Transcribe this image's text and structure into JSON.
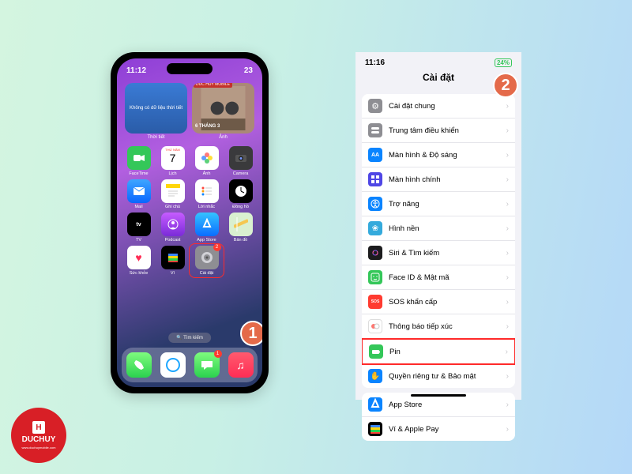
{
  "phone1": {
    "time": "11:12",
    "battery": "23",
    "widgets": {
      "weather": {
        "label": "Thời tiết",
        "text": "Không có dữ liệu thời tiết"
      },
      "photo": {
        "label": "Ảnh",
        "tag": "DUC HUY MOBILE",
        "date": "6 THÁNG 3"
      }
    },
    "apps_row1": [
      {
        "label": "FaceTime",
        "bg": "#34c759",
        "glyph": "video"
      },
      {
        "label": "Lịch",
        "bg": "#ffffff",
        "glyph": "calendar",
        "top": "THỨ NĂM",
        "num": "7"
      },
      {
        "label": "Ảnh",
        "bg": "#ffffff",
        "glyph": "photos"
      },
      {
        "label": "Camera",
        "bg": "#3a3a3c",
        "glyph": "camera"
      }
    ],
    "apps_row2": [
      {
        "label": "Mail",
        "bg": "linear-gradient(#3ea5ff,#0a66ff)",
        "glyph": "mail"
      },
      {
        "label": "Ghi chú",
        "bg": "#ffffff",
        "glyph": "notes"
      },
      {
        "label": "Lời nhắc",
        "bg": "#ffffff",
        "glyph": "reminders"
      },
      {
        "label": "Đồng hồ",
        "bg": "#000000",
        "glyph": "clock"
      }
    ],
    "apps_row3": [
      {
        "label": "TV",
        "bg": "#000000",
        "glyph": "tv"
      },
      {
        "label": "Podcast",
        "bg": "linear-gradient(#c65cff,#7a2bd8)",
        "glyph": "podcast"
      },
      {
        "label": "App Store",
        "bg": "linear-gradient(#35c3ff,#0a6cff)",
        "glyph": "appstore"
      },
      {
        "label": "Bản đồ",
        "bg": "#d9f0d0",
        "glyph": "maps"
      }
    ],
    "apps_row4": [
      {
        "label": "Sức khỏe",
        "bg": "#ffffff",
        "glyph": "health"
      },
      {
        "label": "Ví",
        "bg": "#000000",
        "glyph": "wallet"
      },
      {
        "label": "Cài đặt",
        "bg": "#8e8e93",
        "glyph": "settings",
        "badge": "2",
        "highlight": true
      }
    ],
    "search": "Tìm kiếm",
    "dock": [
      {
        "name": "phone",
        "bg": "linear-gradient(#7efc7e,#2bd14f)"
      },
      {
        "name": "safari",
        "bg": "#ffffff"
      },
      {
        "name": "messages",
        "bg": "linear-gradient(#7efc7e,#2bd14f)",
        "badge": "1"
      },
      {
        "name": "music",
        "bg": "linear-gradient(#ff5a6e,#ff2d55)"
      }
    ],
    "step": "1"
  },
  "phone2": {
    "time": "11:16",
    "battery": "24%",
    "title": "Cài đặt",
    "step": "2",
    "group1": [
      {
        "label": "Cài đặt chung",
        "bg": "#8e8e93",
        "glyph": "gear"
      },
      {
        "label": "Trung tâm điều khiển",
        "bg": "#8e8e93",
        "glyph": "switches"
      },
      {
        "label": "Màn hình & Độ sáng",
        "bg": "#0a84ff",
        "glyph": "AA"
      },
      {
        "label": "Màn hình chính",
        "bg": "#4f46e5",
        "glyph": "grid"
      },
      {
        "label": "Trợ năng",
        "bg": "#0a84ff",
        "glyph": "access"
      },
      {
        "label": "Hình nền",
        "bg": "#34aadc",
        "glyph": "flower"
      },
      {
        "label": "Siri & Tìm kiếm",
        "bg": "#1c1c1e",
        "glyph": "siri"
      },
      {
        "label": "Face ID & Mật mã",
        "bg": "#34c759",
        "glyph": "faceid"
      },
      {
        "label": "SOS khẩn cấp",
        "bg": "#ff3b30",
        "glyph": "SOS"
      },
      {
        "label": "Thông báo tiếp xúc",
        "bg": "#ffffff",
        "glyph": "exposure"
      },
      {
        "label": "Pin",
        "bg": "#34c759",
        "glyph": "battery",
        "highlight": true
      },
      {
        "label": "Quyền riêng tư & Bảo mật",
        "bg": "#0a84ff",
        "glyph": "hand"
      }
    ],
    "group2": [
      {
        "label": "App Store",
        "bg": "#0a84ff",
        "glyph": "appstore"
      },
      {
        "label": "Ví & Apple Pay",
        "bg": "#000000",
        "glyph": "wallet"
      }
    ]
  },
  "brand": {
    "name": "DUCHUY",
    "url": "www.duchuymobile.com",
    "mark": "H"
  }
}
